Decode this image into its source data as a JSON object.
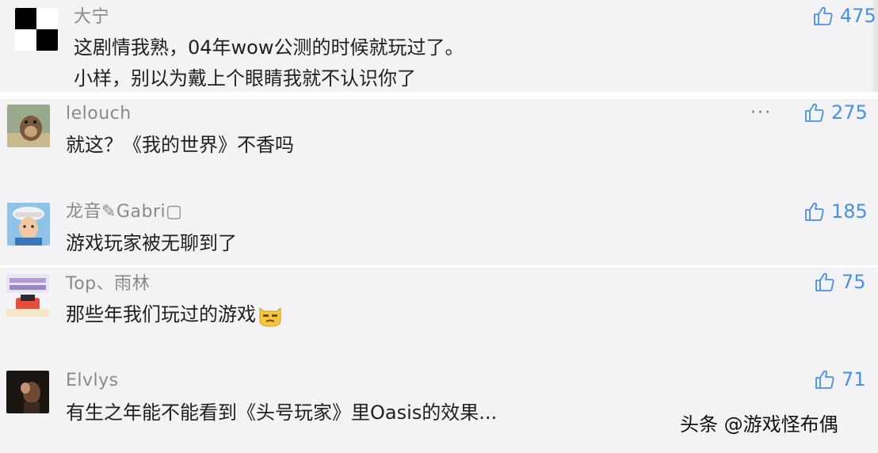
{
  "comments": [
    {
      "username": "大宁",
      "lines": [
        "这剧情我熟，04年wow公测的时候就玩过了。",
        "小样，别以为戴上个眼睛我就不认识你了"
      ],
      "likes": "475"
    },
    {
      "username": "lelouch",
      "lines": [
        "就这？《我的世界》不香吗"
      ],
      "likes": "275",
      "more": "···"
    },
    {
      "username": "龙音✎Gabri▢",
      "lines": [
        "游戏玩家被无聊到了"
      ],
      "likes": "185"
    },
    {
      "username": "Top、雨林",
      "lines": [
        "那些年我们玩过的游戏"
      ],
      "likes": "75"
    },
    {
      "username": "Elvlys",
      "lines": [
        "有生之年能不能看到《头号玩家》里Oasis的效果..."
      ],
      "likes": "71"
    }
  ],
  "watermark": "头条 @游戏怪布偶",
  "colors": {
    "accent": "#4a90e2",
    "username": "#8a8a8a",
    "panel": "#f3f3f5"
  }
}
